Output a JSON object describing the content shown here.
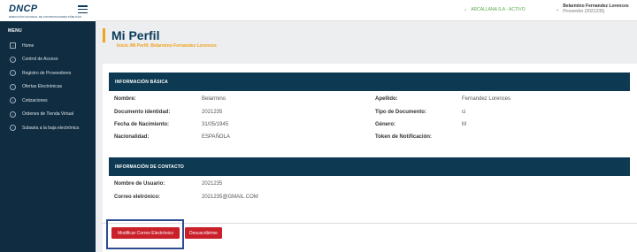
{
  "brand": {
    "logo_text": "DNCP",
    "logo_subtitle": "DIRECCIÓN NACIONAL DE CONTRATACIONES PÚBLICAS"
  },
  "topbar": {
    "company": "ARCALLANA S.A - ACTIVO",
    "user_name": "Belarmino Fernandez Lorences",
    "user_role": "Proveedor (2021235)"
  },
  "sidebar": {
    "title": "MENU",
    "items": [
      {
        "label": "Home",
        "icon": "home-icon"
      },
      {
        "label": "Control de Acceso",
        "icon": "circle-arrow-icon"
      },
      {
        "label": "Registro de Proveedores",
        "icon": "circle-arrow-icon"
      },
      {
        "label": "Ofertas Electrónicas",
        "icon": "circle-arrow-icon"
      },
      {
        "label": "Cotizaciones",
        "icon": "circle-arrow-icon"
      },
      {
        "label": "Ordenes de Tienda Virtual",
        "icon": "circle-arrow-icon"
      },
      {
        "label": "Subasta a la baja electrónica",
        "icon": "circle-arrow-icon"
      }
    ]
  },
  "page": {
    "title": "Mi Perfil",
    "breadcrumb": "Inicio /Mi Perfil: Belarmino Fernandez Lorences"
  },
  "basic_info": {
    "header": "INFORMACIÓN BÁSICA",
    "nombre_label": "Nombre:",
    "nombre_value": "Belarmino",
    "apellido_label": "Apellido:",
    "apellido_value": "Fernandez Lorences",
    "doc_label": "Documento identidad:",
    "doc_value": "2021235",
    "tipo_doc_label": "Tipo de Documento:",
    "tipo_doc_value": "ci",
    "fecha_label": "Fecha de Nacimiento:",
    "fecha_value": "31/05/1945",
    "genero_label": "Género:",
    "genero_value": "M",
    "nacionalidad_label": "Nacionalidad:",
    "nacionalidad_value": "ESPAÑOLA",
    "token_label": "Token de Notificación:",
    "token_value": ""
  },
  "contact_info": {
    "header": "INFORMACIÓN DE CONTACTO",
    "usuario_label": "Nombre de Usuario:",
    "usuario_value": "2021235",
    "correo_label": "Correo eletrónico:",
    "correo_value": "2021235@GMAIL.COM"
  },
  "actions": {
    "modify_email": "Modificar Correo Electrónico",
    "unsubscribe": "Desuscribirme"
  },
  "colors": {
    "sidebar": "#0f2c40",
    "card_header": "#0d3a52",
    "accent": "#f1a21c",
    "button": "#c9202a",
    "highlight": "#2b4d8f"
  }
}
